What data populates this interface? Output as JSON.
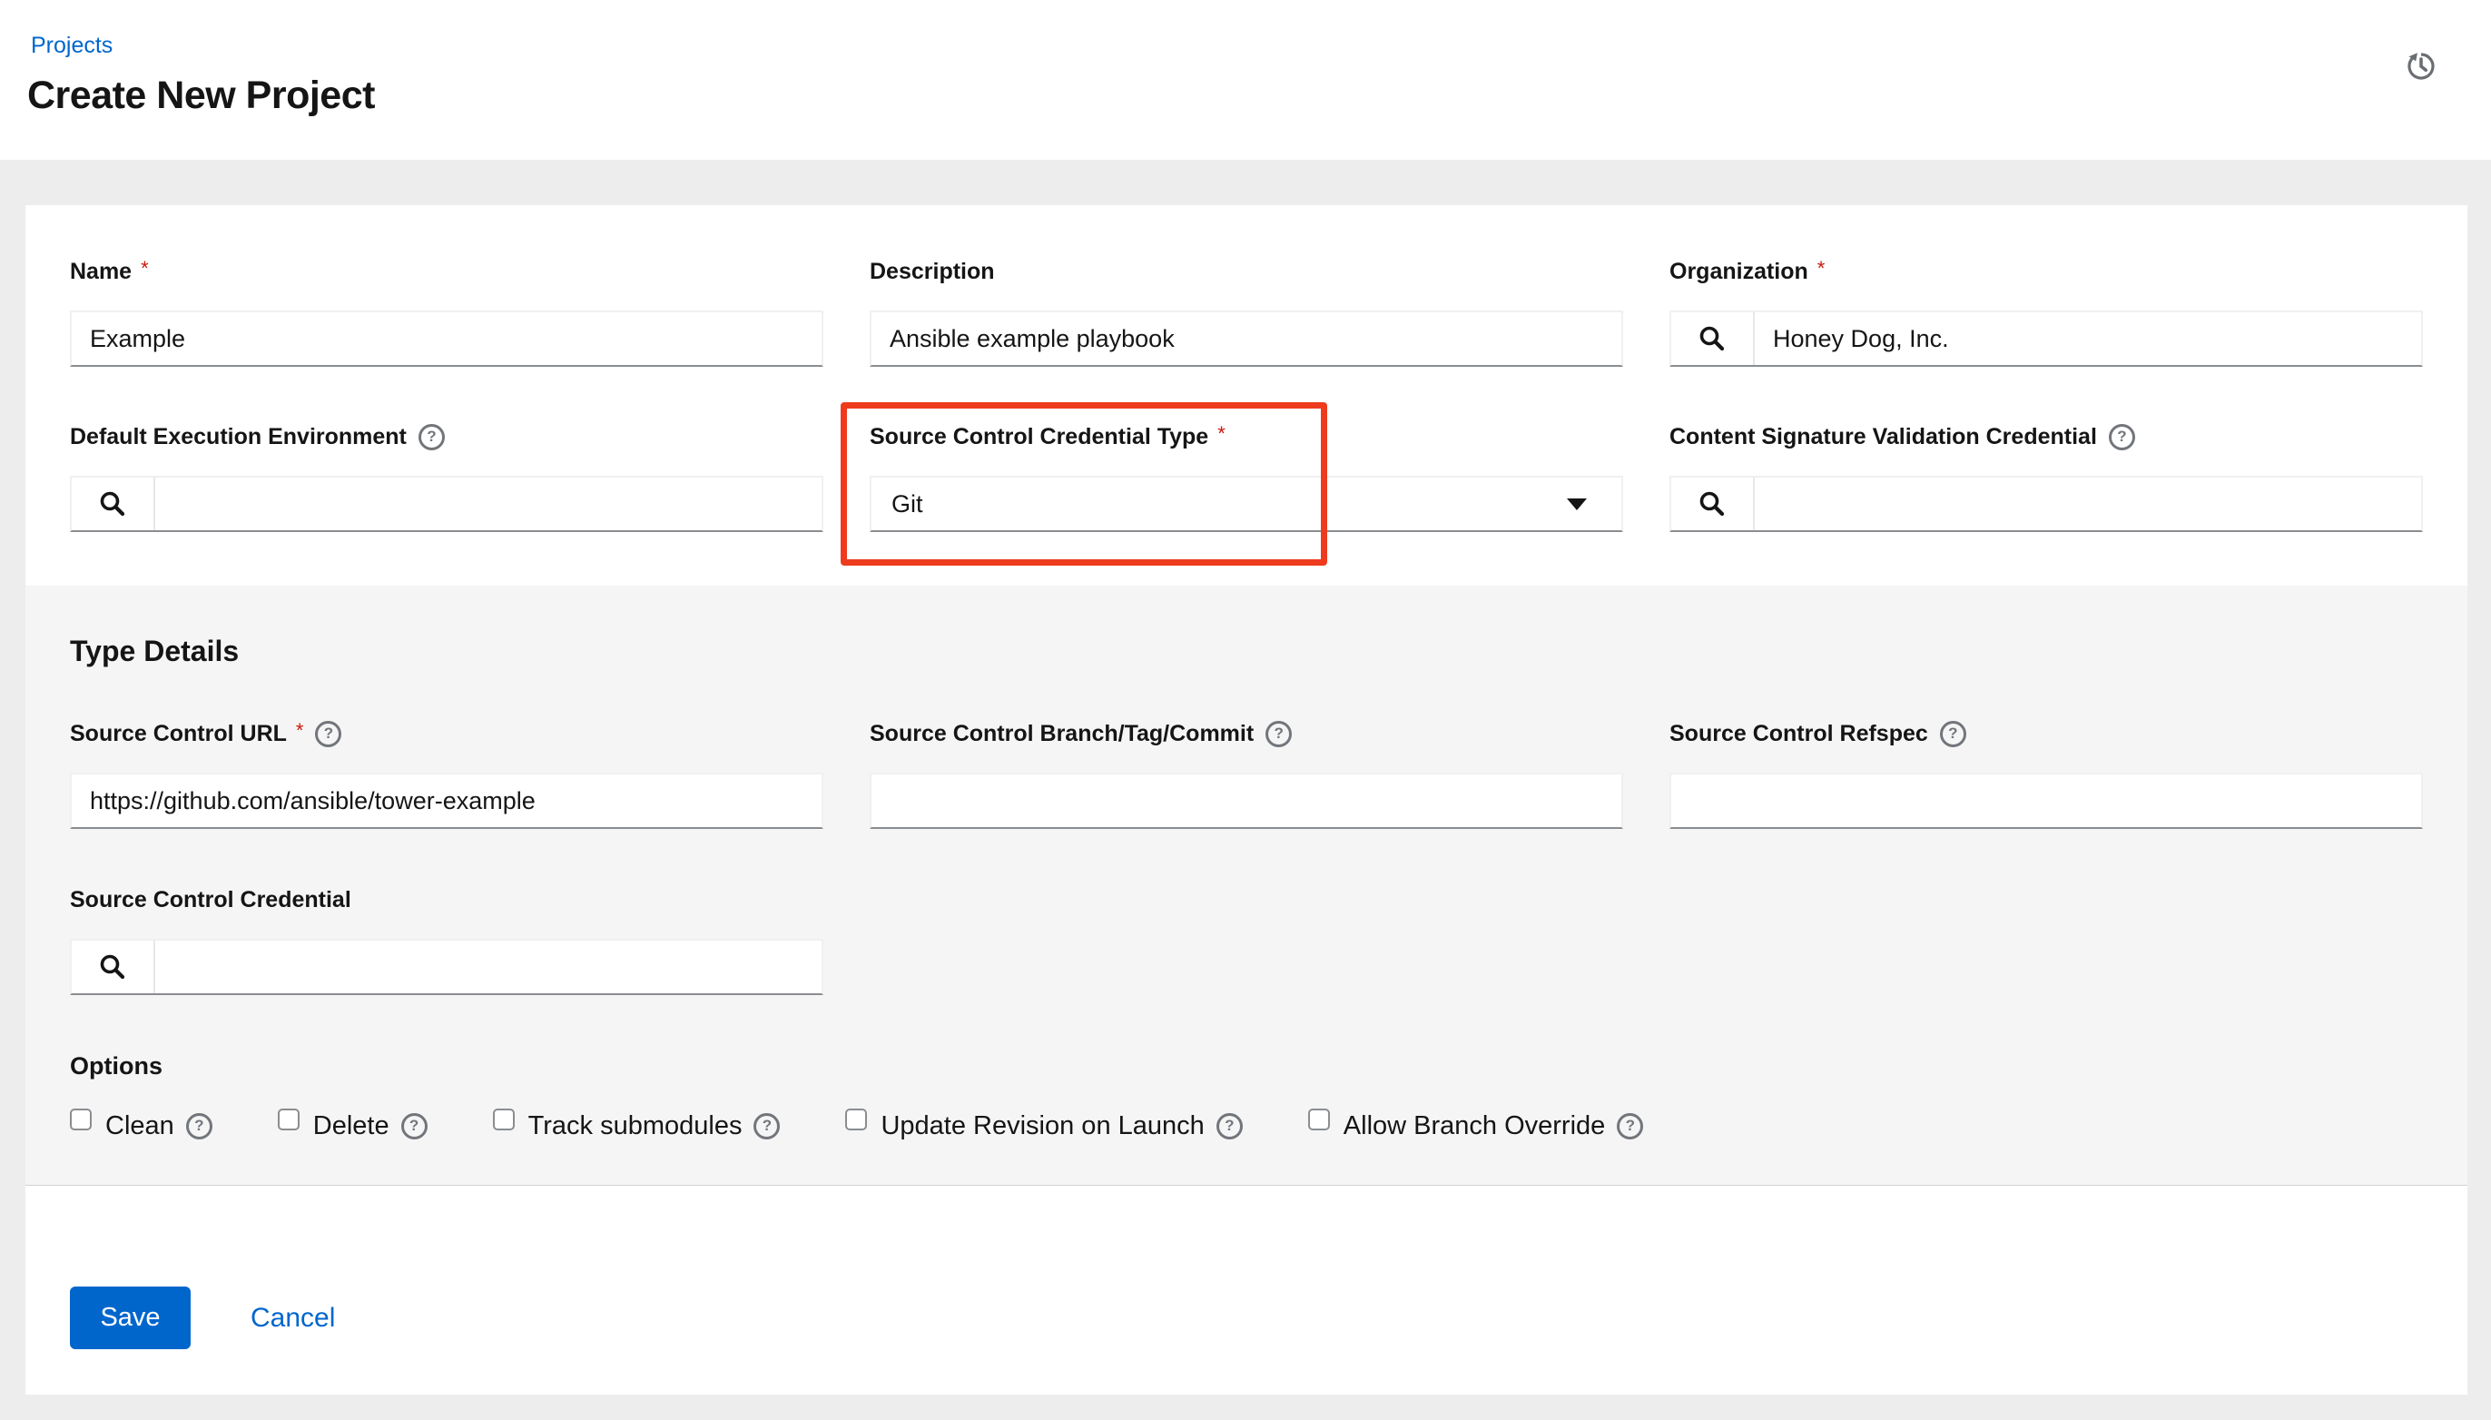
{
  "header": {
    "breadcrumb": "Projects",
    "title": "Create New Project"
  },
  "misc": {
    "required_marker": "*",
    "help_glyph": "?"
  },
  "form": {
    "name": {
      "label": "Name",
      "value": "Example"
    },
    "description": {
      "label": "Description",
      "value": "Ansible example playbook"
    },
    "organization": {
      "label": "Organization",
      "value": "Honey Dog, Inc."
    },
    "default_ee": {
      "label": "Default Execution Environment",
      "value": ""
    },
    "scm_cred_type": {
      "label": "Source Control Credential Type",
      "value": "Git"
    },
    "content_sig": {
      "label": "Content Signature Validation Credential",
      "value": ""
    }
  },
  "type_details": {
    "heading": "Type Details",
    "scm_url": {
      "label": "Source Control URL",
      "value": "https://github.com/ansible/tower-example"
    },
    "scm_branch": {
      "label": "Source Control Branch/Tag/Commit",
      "value": ""
    },
    "scm_refspec": {
      "label": "Source Control Refspec",
      "value": ""
    },
    "scm_credential": {
      "label": "Source Control Credential",
      "value": ""
    }
  },
  "options": {
    "heading": "Options",
    "items": [
      {
        "label": "Clean",
        "checked": false
      },
      {
        "label": "Delete",
        "checked": false
      },
      {
        "label": "Track submodules",
        "checked": false
      },
      {
        "label": "Update Revision on Launch",
        "checked": false
      },
      {
        "label": "Allow Branch Override",
        "checked": false
      }
    ]
  },
  "actions": {
    "save": "Save",
    "cancel": "Cancel"
  },
  "colors": {
    "accent_blue": "#0066cc",
    "required_red": "#c9190b",
    "annotation_red": "#ee3b1e",
    "text": "#151515",
    "icon_gray": "#6a6e73",
    "page_bg": "#ededed",
    "section_bg": "#f5f5f5",
    "input_bottom_border": "#8a8d90"
  }
}
